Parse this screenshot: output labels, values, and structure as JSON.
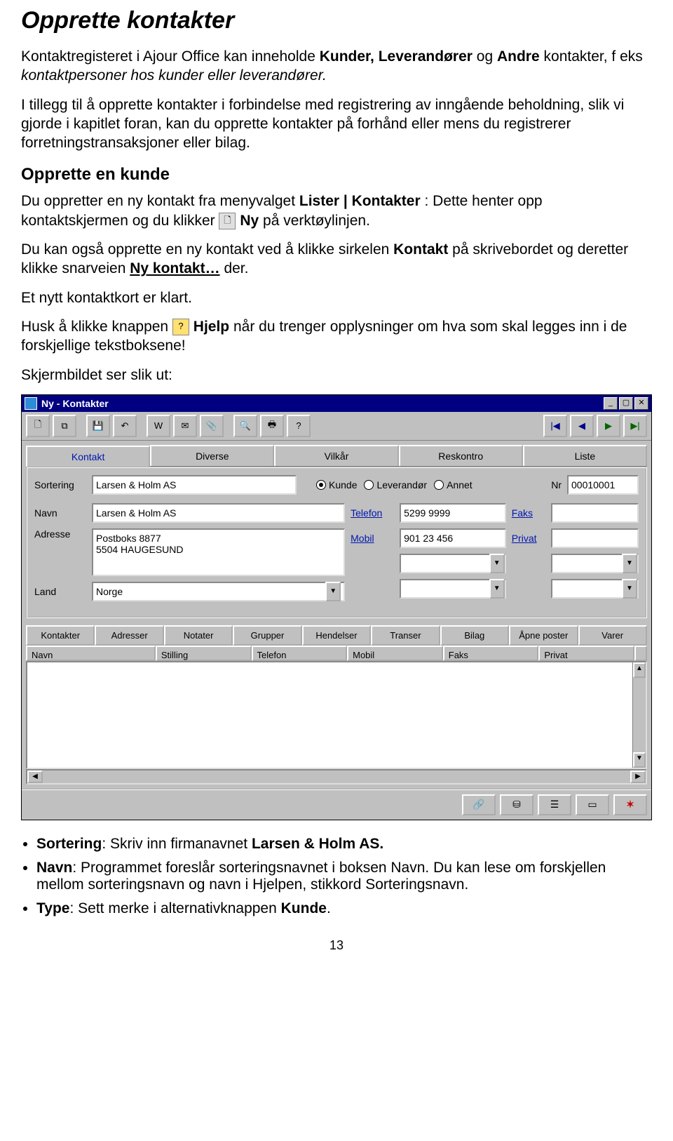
{
  "doc": {
    "title": "Opprette kontakter",
    "p1a": "Kontaktregisteret i Ajour Office kan inneholde ",
    "p1b": "Kunder, Leverandører",
    "p1c": " og ",
    "p1d": "Andre",
    "p1e": " kontakter, f eks ",
    "p1f": "kontaktpersoner hos kunder eller leverandører.",
    "p2": "I tillegg til å opprette kontakter i forbindelse med registrering av inngående beholdning, slik vi gjorde i kapitlet foran, kan du opprette kontakter på forhånd eller mens du registrerer forretningstransaksjoner eller bilag.",
    "h2": "Opprette en kunde",
    "p3a": "Du oppretter en ny kontakt fra menyvalget ",
    "p3b": "Lister | Kontakter",
    "p3c": ": Dette henter opp kontaktskjermen og du klikker ",
    "p3d": "Ny",
    "p3e": " på verktøylinjen.",
    "p4a": "Du kan også opprette en ny kontakt ved å klikke sirkelen ",
    "p4b": "Kontakt",
    "p4c": " på skrivebordet og deretter klikke snarveien ",
    "p4d": "Ny kontakt…",
    "p4e": " der.",
    "p5": "Et nytt kontaktkort er klart.",
    "p6a": "Husk å klikke knappen ",
    "p6b": "Hjelp",
    "p6c": " når du trenger opplysninger om hva som skal legges inn i de forskjellige tekstboksene!",
    "p7": "Skjermbildet ser slik ut:",
    "bul1a": "Sortering",
    "bul1b": ": Skriv inn firmanavnet ",
    "bul1c": "Larsen & Holm AS.",
    "bul2a": "Navn",
    "bul2b": ": Programmet foreslår sorteringsnavnet i boksen Navn. Du kan lese om forskjellen mellom sorteringsnavn og navn i Hjelpen, stikkord Sorteringsnavn.",
    "bul3a": "Type",
    "bul3b": ": Sett merke i alternativknappen ",
    "bul3c": "Kunde",
    "bul3d": ".",
    "pageno": "13"
  },
  "win": {
    "title": "Ny - Kontakter",
    "tabs": [
      "Kontakt",
      "Diverse",
      "Vilkår",
      "Reskontro",
      "Liste"
    ],
    "form": {
      "sortering_lbl": "Sortering",
      "sortering": "Larsen & Holm AS",
      "type_kunde": "Kunde",
      "type_lev": "Leverandør",
      "type_annet": "Annet",
      "nr_lbl": "Nr",
      "nr": "00010001",
      "navn_lbl": "Navn",
      "navn": "Larsen & Holm AS",
      "telefon_lbl": "Telefon",
      "telefon": "5299 9999",
      "faks_lbl": "Faks",
      "adresse_lbl": "Adresse",
      "adresse": "Postboks 8877\n5504 HAUGESUND",
      "mobil_lbl": "Mobil",
      "mobil": "901 23 456",
      "privat_lbl": "Privat",
      "land_lbl": "Land",
      "land": "Norge"
    },
    "subtabs": [
      "Kontakter",
      "Adresser",
      "Notater",
      "Grupper",
      "Hendelser",
      "Transer",
      "Bilag",
      "Åpne poster",
      "Varer"
    ],
    "gridcols": [
      "Navn",
      "Stilling",
      "Telefon",
      "Mobil",
      "Faks",
      "Privat"
    ]
  }
}
